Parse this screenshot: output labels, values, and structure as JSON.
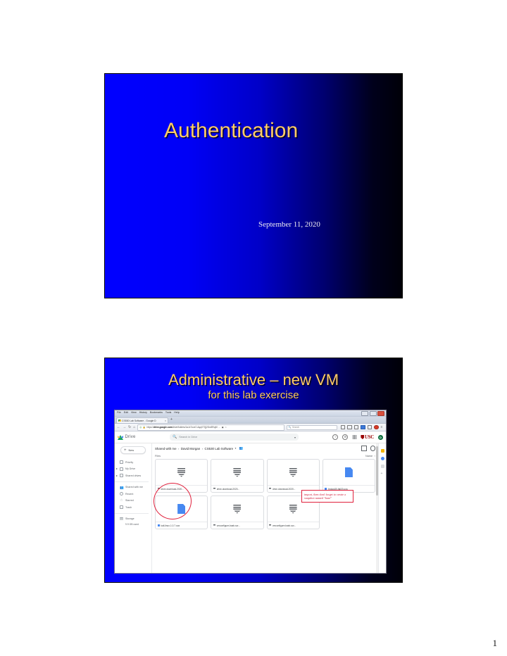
{
  "document": {
    "page_number": "1"
  },
  "slide1": {
    "title": "Authentication",
    "date": "September 11, 2020"
  },
  "slide2": {
    "title": "Administrative – new VM",
    "subtitle": "for this lab exercise",
    "browser": {
      "menu_items": [
        "File",
        "Edit",
        "View",
        "History",
        "Bookmarks",
        "Tools",
        "Help"
      ],
      "window_controls": [
        "minimize",
        "maximize",
        "close"
      ],
      "tab": {
        "label": "CS530 Lab Software - Google D",
        "close_label": "×",
        "new_tab_label": "+"
      },
      "nav": {
        "back": "←",
        "forward": "→",
        "reload": "↻",
        "home": "⌂",
        "shield_icon": "shield-icon",
        "lock_icon": "🔒",
        "url_prefix": "https://",
        "url_domain": "drive.google.com",
        "url_path": "/drive/folders/1aJo7ova7-AqqV7Qj2Gw3Ruj6l",
        "menu_ellipsis": "…",
        "reader_icon": "reader-icon",
        "star_icon": "☆",
        "search_placeholder": "Search",
        "search_engine_icon": "search-engine-icon"
      }
    },
    "drive": {
      "app_name": "Drive",
      "search_placeholder": "Search in Drive",
      "help_icon": "?",
      "settings_icon": "⚙",
      "apps_icon": "apps-grid-icon",
      "org_logo": "USC",
      "avatar_initial": "D",
      "new_button": "New",
      "sidebar": [
        {
          "label": "Priority",
          "icon": "priority-icon",
          "expandable": false
        },
        {
          "label": "My Drive",
          "icon": "drive-icon",
          "expandable": true
        },
        {
          "label": "Shared drives",
          "icon": "shared-drives-icon",
          "expandable": true
        },
        {
          "label": "Shared with me",
          "icon": "people-icon",
          "expandable": false
        },
        {
          "label": "Recent",
          "icon": "clock-icon",
          "expandable": false
        },
        {
          "label": "Starred",
          "icon": "star-icon",
          "expandable": false
        },
        {
          "label": "Trash",
          "icon": "trash-icon",
          "expandable": false
        },
        {
          "label": "Storage",
          "icon": "storage-icon",
          "expandable": false
        }
      ],
      "storage_used": "9.9 GB used",
      "breadcrumb": [
        "Shared with me",
        "David Morgan",
        "CS530 Lab Software"
      ],
      "breadcrumb_separator": "›",
      "files_label": "Files",
      "sort_label": "Name",
      "sort_arrow": "↑",
      "files": [
        {
          "name": "drive-download-2020...",
          "type": "zip"
        },
        {
          "name": "drive-download-2020...",
          "type": "zip"
        },
        {
          "name": "drive-download-2020...",
          "type": "zip"
        },
        {
          "name": "fedora30-fall20.ova",
          "type": "ova"
        },
        {
          "name": "kali-linux-1.0.7.ova",
          "type": "ova"
        },
        {
          "name": "vmconfigure-bash-scr...",
          "type": "zip"
        },
        {
          "name": "vmconfigure-bash-scr...",
          "type": "zip"
        }
      ],
      "annotation": "import, then don't forget to create a snapshot named “base”"
    }
  },
  "colors": {
    "slide_bg_left": "#0000ff",
    "slide_bg_right": "#000008",
    "title_gold": "#ffcc66",
    "annotation_red": "#d21f3c",
    "drive_blue": "#4688f1",
    "usc_cardinal": "#990000"
  }
}
